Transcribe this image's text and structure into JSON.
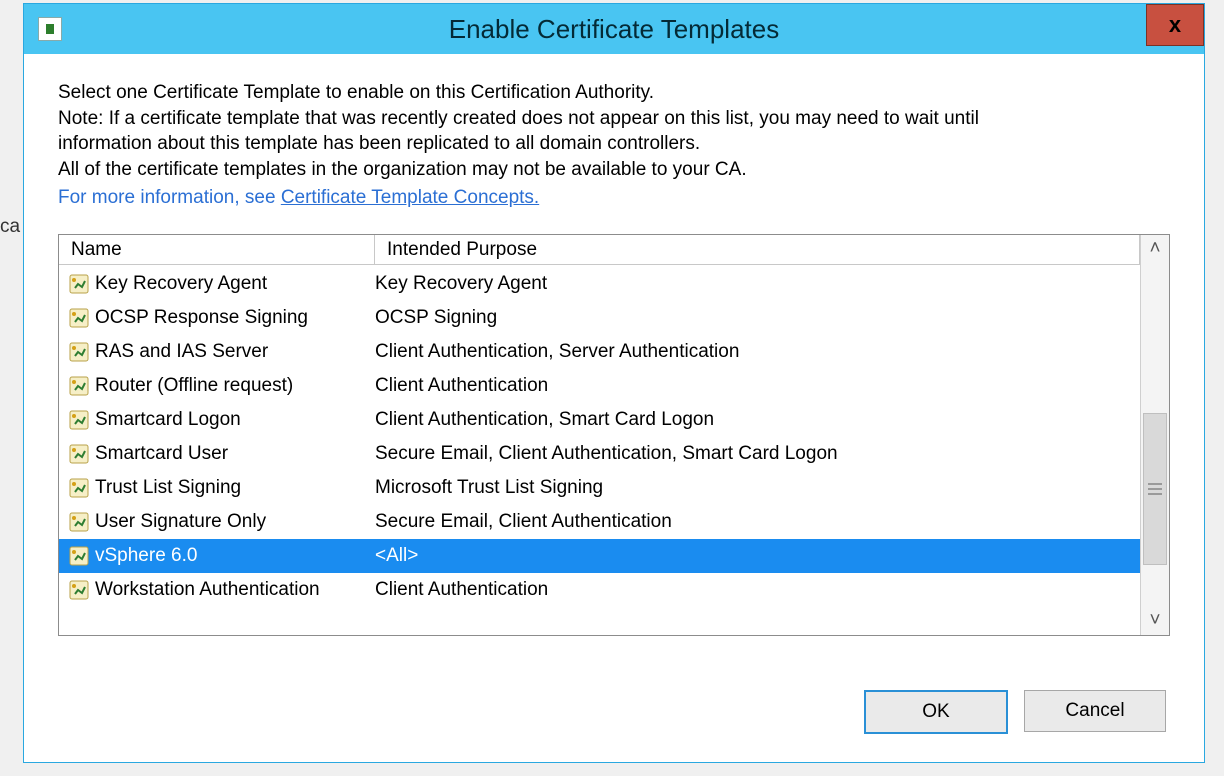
{
  "stray": "ca",
  "window": {
    "title": "Enable Certificate Templates",
    "close_glyph": "x"
  },
  "intro": {
    "line1": "Select one Certificate Template to enable on this Certification Authority.",
    "line2": "Note: If a certificate template that was recently created does not appear on this list, you may need to wait until",
    "line3": "information about this template has been replicated to all domain controllers.",
    "line4": "All of the certificate templates in the organization may not be available to your CA.",
    "link_prefix": "For more information, see ",
    "link_text": "Certificate Template Concepts."
  },
  "columns": {
    "name": "Name",
    "purpose": "Intended Purpose"
  },
  "rows": [
    {
      "name": "Key Recovery Agent",
      "purpose": "Key Recovery Agent",
      "selected": false
    },
    {
      "name": "OCSP Response Signing",
      "purpose": "OCSP Signing",
      "selected": false
    },
    {
      "name": "RAS and IAS Server",
      "purpose": "Client Authentication, Server Authentication",
      "selected": false
    },
    {
      "name": "Router (Offline request)",
      "purpose": "Client Authentication",
      "selected": false
    },
    {
      "name": "Smartcard Logon",
      "purpose": "Client Authentication, Smart Card Logon",
      "selected": false
    },
    {
      "name": "Smartcard User",
      "purpose": "Secure Email, Client Authentication, Smart Card Logon",
      "selected": false
    },
    {
      "name": "Trust List Signing",
      "purpose": "Microsoft Trust List Signing",
      "selected": false
    },
    {
      "name": "User Signature Only",
      "purpose": "Secure Email, Client Authentication",
      "selected": false
    },
    {
      "name": "vSphere 6.0",
      "purpose": "<All>",
      "selected": true
    },
    {
      "name": "Workstation Authentication",
      "purpose": "Client Authentication",
      "selected": false
    }
  ],
  "scroll": {
    "up": "˄",
    "down": "˅",
    "grip": "≡"
  },
  "buttons": {
    "ok": "OK",
    "cancel": "Cancel"
  }
}
